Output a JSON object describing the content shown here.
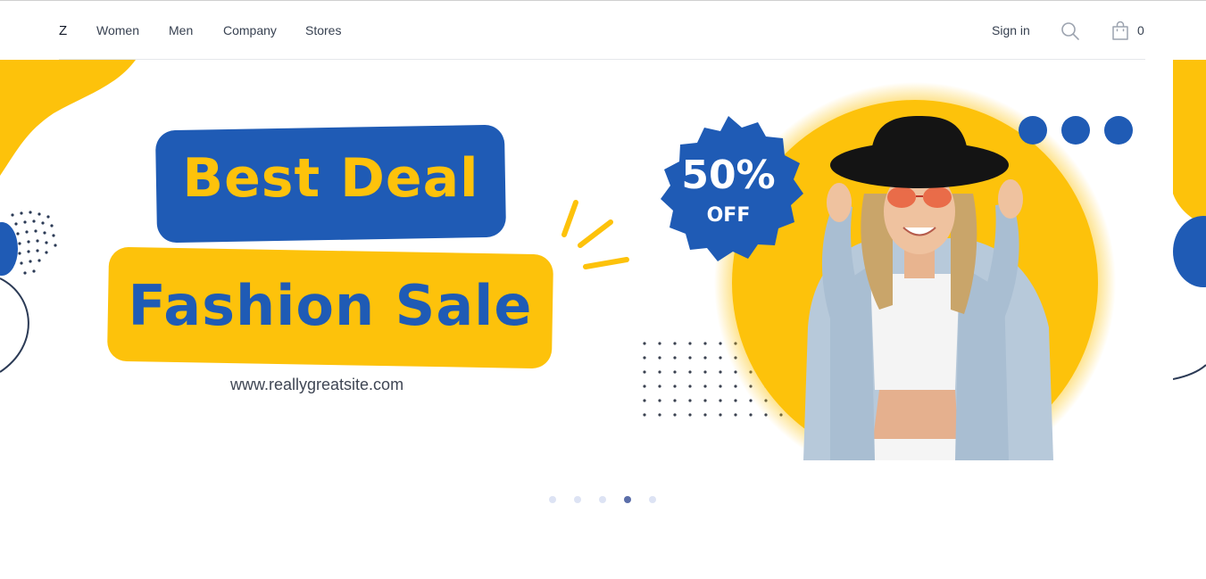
{
  "header": {
    "logo": "Z",
    "nav": [
      {
        "label": "Women"
      },
      {
        "label": "Men"
      },
      {
        "label": "Company"
      },
      {
        "label": "Stores"
      }
    ],
    "sign_in": "Sign in",
    "cart_count": "0"
  },
  "banner": {
    "line1": "Best Deal",
    "line2": "Fashion Sale",
    "site": "www.reallygreatsite.com",
    "badge_percent": "50%",
    "badge_off": "OFF"
  },
  "carousel": {
    "dots": 5,
    "active_index": 3
  },
  "colors": {
    "brand_blue": "#1f5bb5",
    "brand_yellow": "#fdc20b",
    "dot_inactive": "#dde3f4",
    "dot_active": "#5b6ea9"
  },
  "icons": [
    "search-icon",
    "shopping-bag-icon"
  ]
}
